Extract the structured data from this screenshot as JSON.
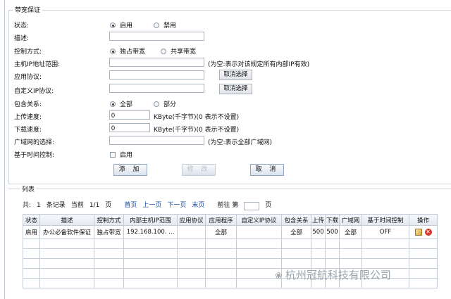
{
  "section": {
    "title": "带宽保证"
  },
  "form": {
    "status": {
      "label": "状态:",
      "options": [
        "启用",
        "禁用"
      ],
      "selected": 0
    },
    "description": {
      "label": "描述:",
      "value": ""
    },
    "control_mode": {
      "label": "控制方式:",
      "options": [
        "独占带宽",
        "共享带宽"
      ],
      "selected": 0
    },
    "ip_range": {
      "label": "主机IP地址范围:",
      "value": "",
      "note": "(为空:表示对该规定所有内部IP有效)"
    },
    "app_protocol": {
      "label": "应用协议:",
      "value": "",
      "button": "取消选择"
    },
    "custom_ip_protocol": {
      "label": "自定义IP协议:",
      "value": "",
      "button": "取消选择"
    },
    "include": {
      "label": "包含关系:",
      "options": [
        "全部",
        "部分"
      ],
      "selected": 0
    },
    "upload": {
      "label": "上传速度:",
      "value": "0",
      "note": "KByte(千字节)(0 表示不设置)"
    },
    "download": {
      "label": "下载速度:",
      "value": "0",
      "note": "KByte(千字节)(0 表示不设置)"
    },
    "wan": {
      "label": "广域网的选择:",
      "value": "",
      "note": "(为空:表示全部广域网)"
    },
    "time_control": {
      "label": "基于时间控制:",
      "checkbox_label": "启用",
      "checked": false
    }
  },
  "buttons": {
    "add": "添 加",
    "modify": "修 改",
    "cancel": "取 消"
  },
  "list": {
    "title": "列表",
    "pager": {
      "total_label": "共:",
      "total": "1",
      "records_label": "条记录",
      "current_label": "当前",
      "page_info": "1/1",
      "page_label": "页",
      "first": "首页",
      "prev": "上一页",
      "next": "下一页",
      "last": "末页",
      "goto_label": "前往 第",
      "goto_value": "",
      "goto_suffix": "页"
    },
    "columns": [
      "状态",
      "描述",
      "控制方式",
      "内部主机IP范围",
      "应用协议",
      "应用程序",
      "自定义IP协议",
      "包含关系",
      "上传",
      "下载",
      "广域网",
      "基于时间控制",
      "操作"
    ],
    "rows": [
      [
        "启用",
        "办公必备软件保证",
        "独占带宽",
        "192.168.100. ...",
        "",
        "全部",
        "",
        "全部",
        "500",
        "500",
        "全部",
        "OFF",
        ""
      ]
    ]
  },
  "watermark": {
    "text": "杭州冠航科技有限公司",
    "icon": "wechat-icon"
  }
}
